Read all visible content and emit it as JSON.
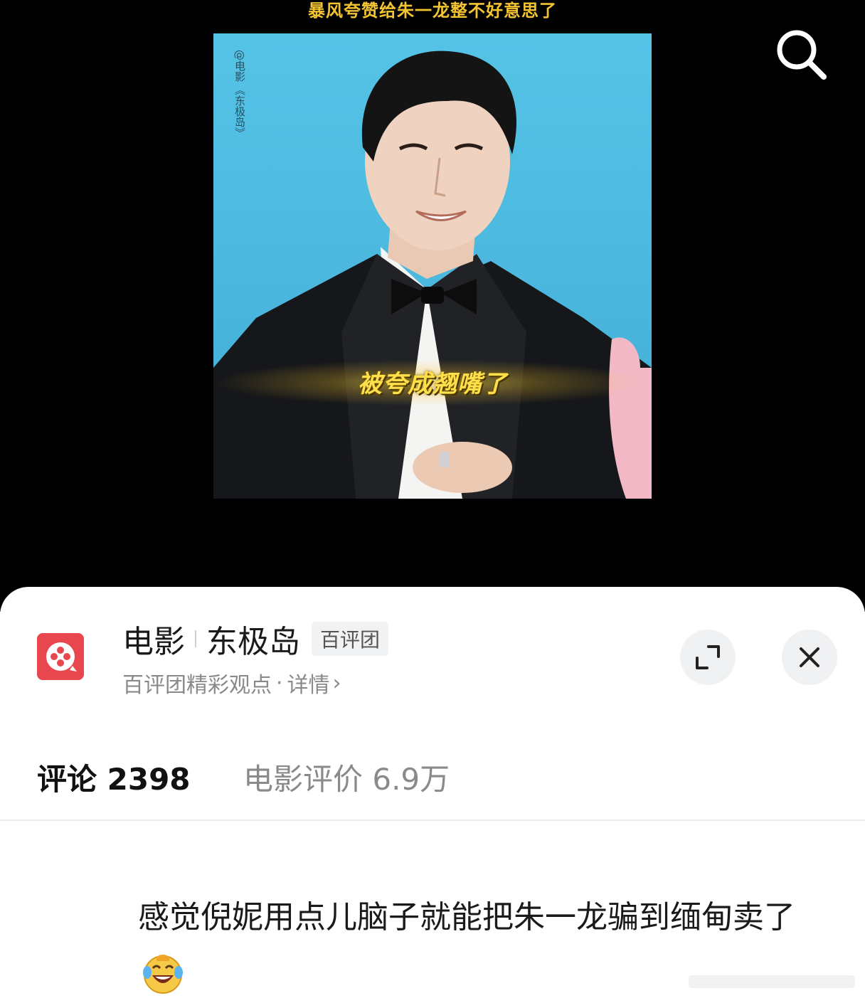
{
  "video": {
    "top_caption": "暴风夸赞给朱一龙整不好意思了",
    "watermark": [
      "@电影",
      "《东极岛》"
    ],
    "subtitle": "被夸成翘嘴了"
  },
  "sheet": {
    "title_part1": "电影",
    "title_part2": "东极岛",
    "badge": "百评团",
    "subtitle_text": "百评团精彩观点",
    "subtitle_dot": "·",
    "details_link": "详情",
    "details_chevron": "›"
  },
  "tabs": {
    "comments_label": "评论 2398",
    "rating_label": "电影评价 6.9万"
  },
  "comment": {
    "text": "感觉倪妮用点儿脑子就能把朱一龙骗到缅甸卖了",
    "emoji": "laughing-crying-emoji"
  },
  "colors": {
    "caption": "#f3c431",
    "subtitle": "#ffe04a",
    "app_icon": "#e8474f",
    "sky": "#4ab6dd"
  }
}
